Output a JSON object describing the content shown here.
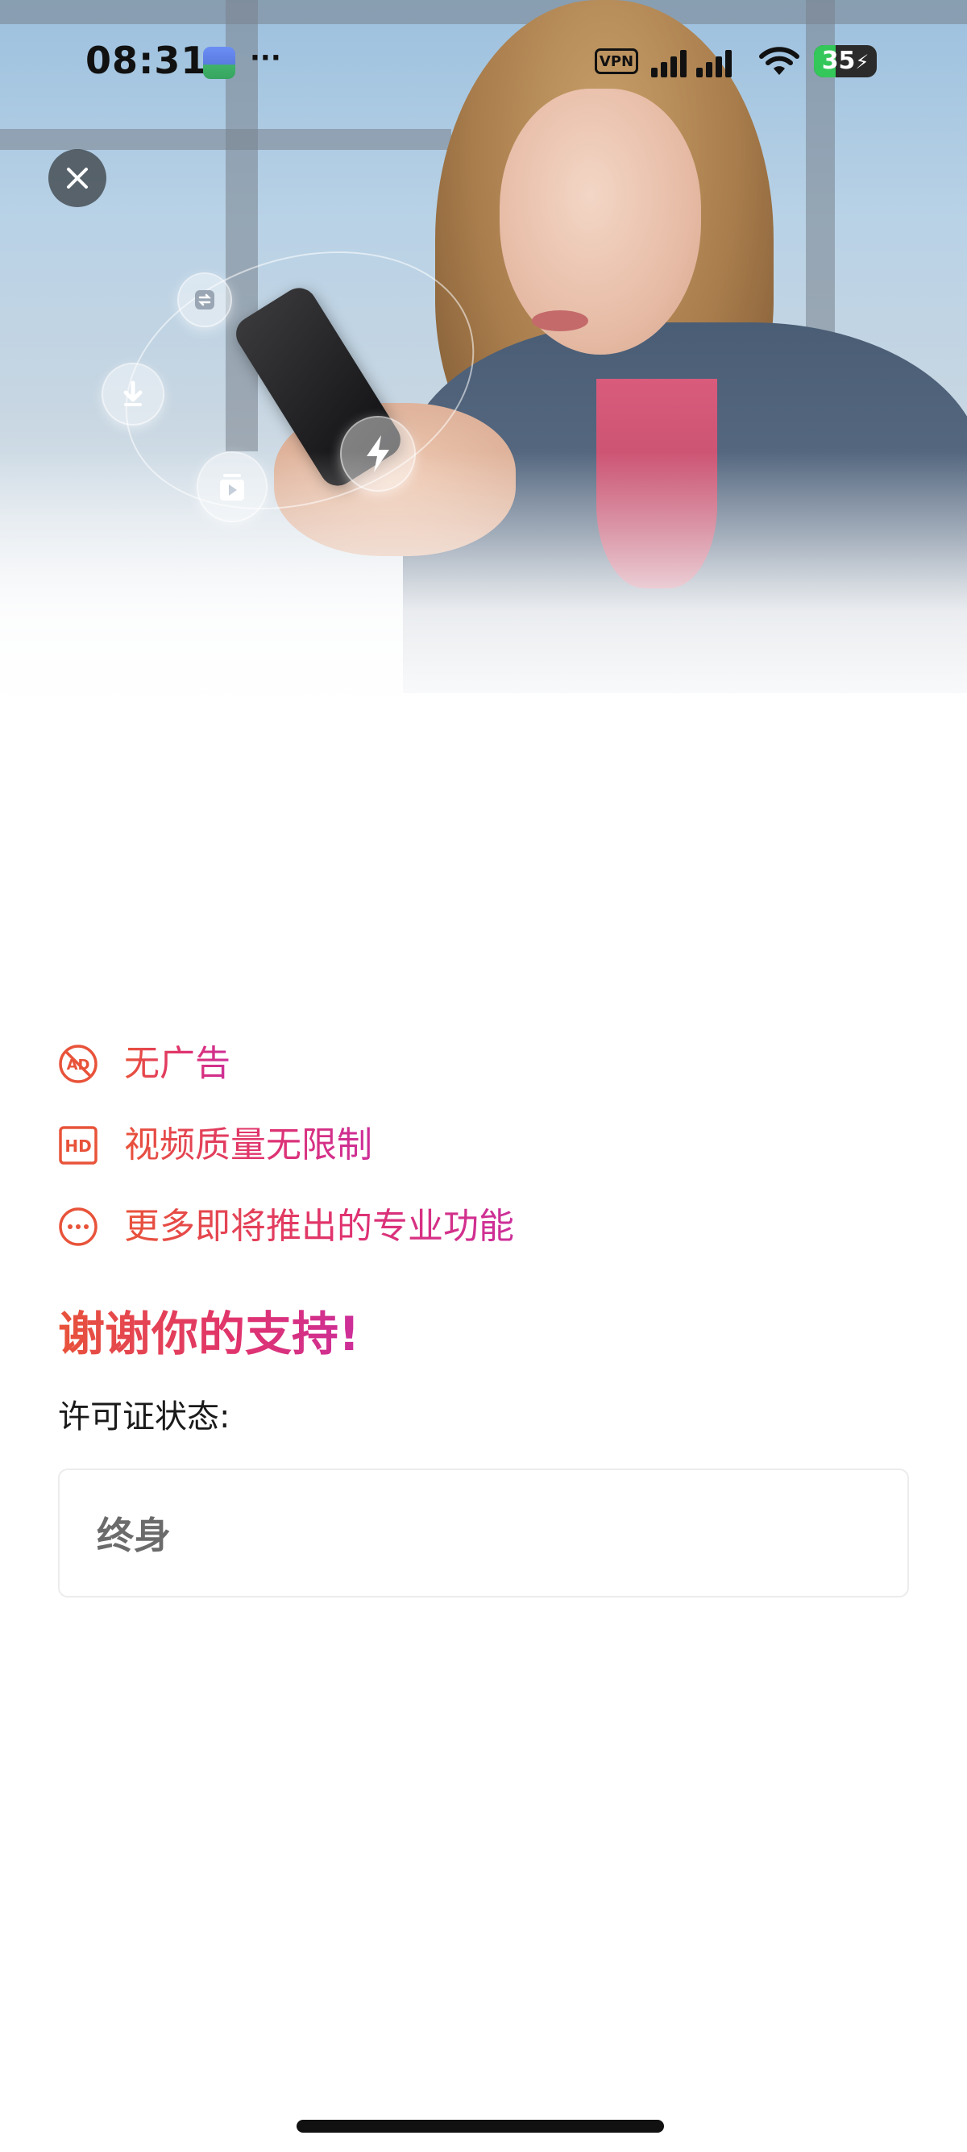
{
  "status_bar": {
    "time": "08:31",
    "more": "···",
    "vpn": "VPN",
    "battery": "35",
    "battery_level_percent": 35
  },
  "close": {
    "icon": "close-icon"
  },
  "hero": {
    "bubble_icons": [
      "sync-icon",
      "download-icon",
      "video-play-icon",
      "lightning-icon"
    ]
  },
  "features": [
    {
      "icon": "no-ads-icon",
      "label": "无广告"
    },
    {
      "icon": "hd-icon",
      "label": "视频质量无限制"
    },
    {
      "icon": "more-icon",
      "label": "更多即将推出的专业功能"
    }
  ],
  "thanks": "谢谢你的支持!",
  "license": {
    "label": "许可证状态:",
    "value": "终身"
  },
  "colors": {
    "gradient_start": "#e8533a",
    "gradient_end": "#cc2e9a",
    "feature_icon": "#e8533a"
  }
}
